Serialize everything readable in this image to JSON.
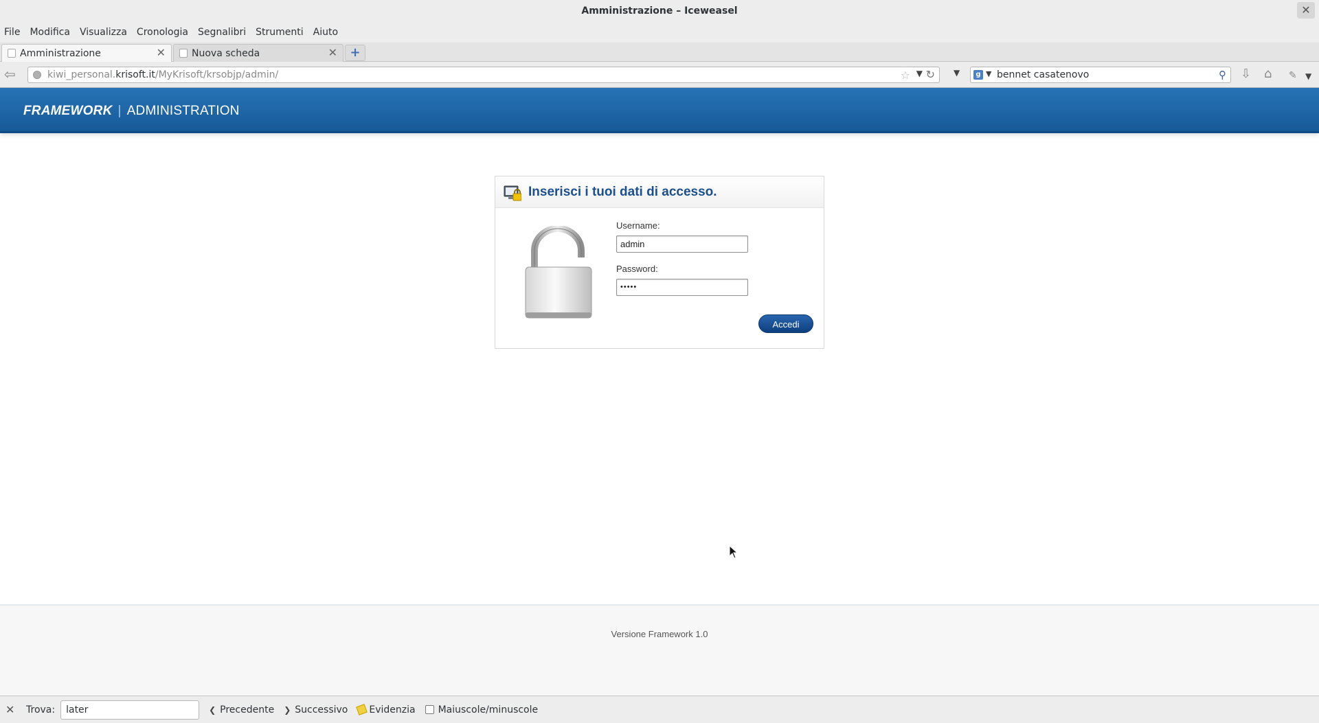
{
  "window": {
    "title": "Amministrazione – Iceweasel",
    "close_glyph": "✕"
  },
  "menu": {
    "items": [
      "File",
      "Modifica",
      "Visualizza",
      "Cronologia",
      "Segnalibri",
      "Strumenti",
      "Aiuto"
    ]
  },
  "tabs": [
    {
      "label": "Amministrazione",
      "active": true
    },
    {
      "label": "Nuova scheda",
      "active": false
    }
  ],
  "navbar": {
    "url_prefix": "kiwi_personal.",
    "url_domain": "krisoft.it",
    "url_path": "/MyKrisoft/krsobjp/admin/",
    "search_engine": "Google",
    "search_value": "bennet casatenovo"
  },
  "site": {
    "brand_framework": "FRAMEWORK",
    "brand_separator": "|",
    "brand_section": "ADMINISTRATION"
  },
  "login": {
    "title": "Inserisci i tuoi dati di accesso.",
    "username_label": "Username:",
    "username_value": "admin",
    "password_label": "Password:",
    "password_value": "•••••",
    "submit_label": "Accedi"
  },
  "footer": {
    "version_text": "Versione Framework 1.0"
  },
  "findbar": {
    "label": "Trova:",
    "value": "later",
    "prev_label": "Precedente",
    "next_label": "Successivo",
    "highlight_label": "Evidenzia",
    "match_case_label": "Maiuscole/minuscole",
    "match_case_checked": false
  },
  "colors": {
    "header_blue": "#1b62a6",
    "title_blue": "#1b4f8f",
    "button_blue": "#0d3f80"
  }
}
